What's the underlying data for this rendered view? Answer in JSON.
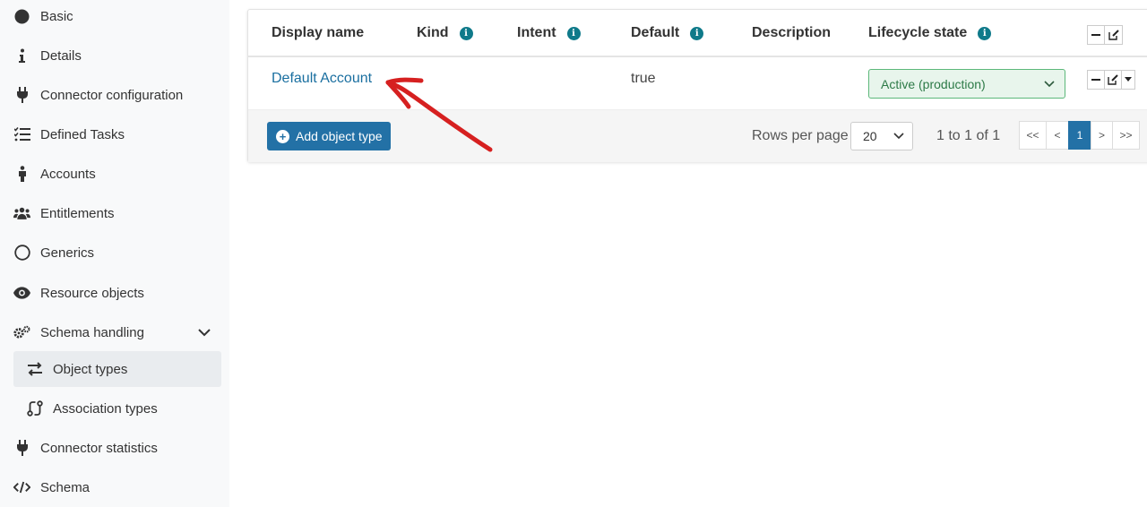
{
  "sidebar": {
    "items": [
      {
        "label": "Basic",
        "icon": "circle-filled-icon"
      },
      {
        "label": "Details",
        "icon": "info-icon"
      },
      {
        "label": "Connector configuration",
        "icon": "plug-icon"
      },
      {
        "label": "Defined Tasks",
        "icon": "task-list-icon"
      },
      {
        "label": "Accounts",
        "icon": "person-icon"
      },
      {
        "label": "Entitlements",
        "icon": "users-icon"
      },
      {
        "label": "Generics",
        "icon": "circle-outline-icon"
      },
      {
        "label": "Resource objects",
        "icon": "eye-icon"
      },
      {
        "label": "Schema handling",
        "icon": "cogs-icon"
      },
      {
        "label": "Object types",
        "icon": "exchange-icon"
      },
      {
        "label": "Association types",
        "icon": "association-icon"
      },
      {
        "label": "Connector statistics",
        "icon": "plug-icon"
      },
      {
        "label": "Schema",
        "icon": "code-icon"
      }
    ]
  },
  "table": {
    "columns": [
      "Display name",
      "Kind",
      "Intent",
      "Default",
      "Description",
      "Lifecycle state"
    ],
    "rows": [
      {
        "display_name": "Default Account",
        "kind": "",
        "intent": "",
        "default": "true",
        "description": "",
        "lifecycle_state": "Active (production)"
      }
    ]
  },
  "footer": {
    "add_button": "Add object type",
    "rows_per_page_label": "Rows per page",
    "rows_per_page_value": "20",
    "range_text": "1 to 1 of 1",
    "pager": {
      "first": "<<",
      "prev": "<",
      "current": "1",
      "next": ">",
      "last": ">>"
    }
  },
  "colors": {
    "link": "#1a6fa0",
    "primary": "#2371a6",
    "info": "#0f7a8a",
    "lifecycle_bg": "#e8f5ec",
    "lifecycle_border": "#5cb87a",
    "annotation_arrow": "#d62020"
  }
}
